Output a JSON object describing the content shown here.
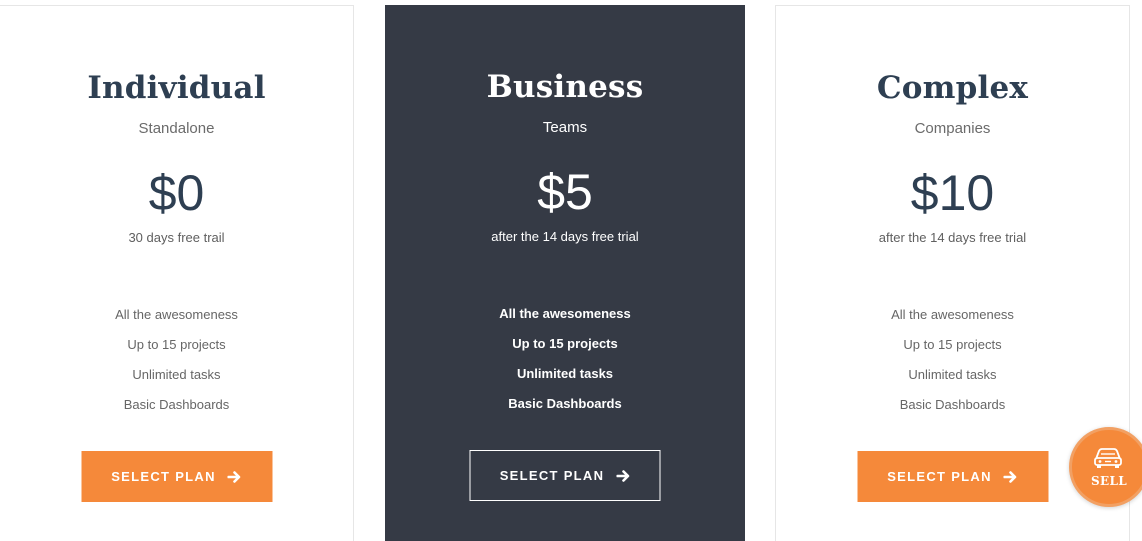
{
  "plans": [
    {
      "name": "Individual",
      "subtitle": "Standalone",
      "price": "$0",
      "note": "30 days free trail",
      "features": [
        "All the awesomeness",
        "Up to 15 projects",
        "Unlimited tasks",
        "Basic Dashboards"
      ],
      "button_label": "SELECT PLAN",
      "button_icon": "arrow-right-icon"
    },
    {
      "name": "Business",
      "subtitle": "Teams",
      "price": "$5",
      "note": "after the 14 days free trial",
      "features": [
        "All the awesomeness",
        "Up to 15 projects",
        "Unlimited tasks",
        "Basic Dashboards"
      ],
      "button_label": "SELECT PLAN",
      "button_icon": "arrow-right-icon"
    },
    {
      "name": "Complex",
      "subtitle": "Companies",
      "price": "$10",
      "note": "after the 14 days free trial",
      "features": [
        "All the awesomeness",
        "Up to 15 projects",
        "Unlimited tasks",
        "Basic Dashboards"
      ],
      "button_label": "SELECT PLAN",
      "button_icon": "arrow-right-icon"
    }
  ],
  "fab": {
    "label": "SELL",
    "icon": "car-icon"
  },
  "colors": {
    "accent": "#f5893a",
    "dark_card": "#353a45",
    "heading": "#2e3f52"
  }
}
